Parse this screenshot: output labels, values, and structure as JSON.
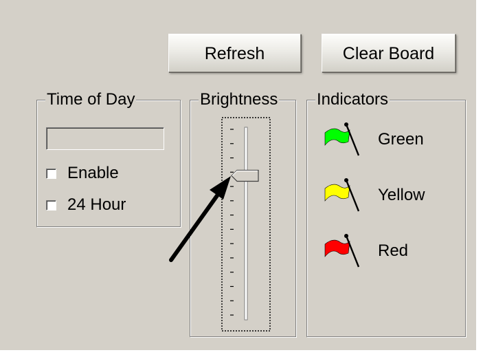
{
  "toolbar": {
    "refresh_label": "Refresh",
    "clear_board_label": "Clear Board"
  },
  "time_of_day": {
    "legend": "Time of Day",
    "time_value": "",
    "enable": {
      "label": "Enable",
      "checked": false
    },
    "hour24": {
      "label": "24 Hour",
      "checked": false
    }
  },
  "brightness": {
    "legend": "Brightness",
    "slider_level": 0.75,
    "tick_count": 14
  },
  "indicators": {
    "legend": "Indicators",
    "items": [
      {
        "label": "Green",
        "color": "#00ff00",
        "icon": "flag-icon"
      },
      {
        "label": "Yellow",
        "color": "#ffff00",
        "icon": "flag-icon"
      },
      {
        "label": "Red",
        "color": "#ff0000",
        "icon": "flag-icon"
      }
    ]
  },
  "annotation": {
    "icon": "arrow-icon",
    "color": "#000000"
  }
}
